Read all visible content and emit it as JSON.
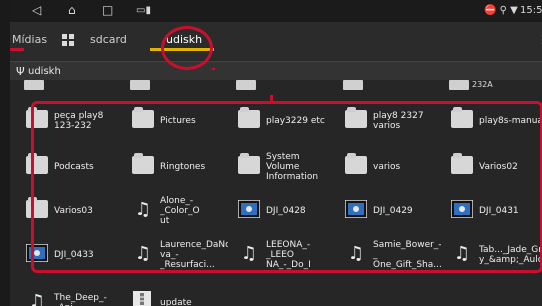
{
  "status": {
    "nav_back": "◁",
    "nav_home": "⌂",
    "nav_recent": "□",
    "status_icons": "⛔ ⚲ ▼",
    "time": "15:5"
  },
  "tabs": [
    {
      "label": "Mídias",
      "active": false
    },
    {
      "label": "",
      "active": false,
      "icon": "grid-icon"
    },
    {
      "label": "sdcard",
      "active": false
    },
    {
      "label": "udiskh",
      "active": true
    }
  ],
  "path": {
    "icon": "usb-icon",
    "label": "udiskh"
  },
  "top_partial": {
    "last_label": "232A"
  },
  "items": [
    {
      "name": "peça play8\n123-232",
      "type": "folder"
    },
    {
      "name": "Pictures",
      "type": "folder"
    },
    {
      "name": "play3229 etc",
      "type": "folder"
    },
    {
      "name": "play8 2327\nvarios",
      "type": "folder"
    },
    {
      "name": "play8s-manual",
      "type": "folder"
    },
    {
      "name": "Podcasts",
      "type": "folder"
    },
    {
      "name": "Ringtones",
      "type": "folder"
    },
    {
      "name": "System Volume\nInformation",
      "type": "folder"
    },
    {
      "name": "varios",
      "type": "folder"
    },
    {
      "name": "Varios02",
      "type": "folder"
    },
    {
      "name": "Varios03",
      "type": "folder"
    },
    {
      "name": "Alone_-_Color_O\nut",
      "type": "music"
    },
    {
      "name": "DJI_0428",
      "type": "video"
    },
    {
      "name": "DJI_0429",
      "type": "video"
    },
    {
      "name": "DJI_0431",
      "type": "video"
    },
    {
      "name": "DJI_0433",
      "type": "video"
    },
    {
      "name": "Laurence_DaNo\nva_-_Resurfaci...",
      "type": "music"
    },
    {
      "name": "LEEONA_-_LEEO\nNA_-_Do_I",
      "type": "music"
    },
    {
      "name": "Samie_Bower_-_\nOne_Gift_Sha...",
      "type": "music"
    },
    {
      "name": "Tab..._Jade_Grit\ny_&amp;_Aulc)",
      "type": "music"
    },
    {
      "name": "The_Deep_-_Ani",
      "type": "music"
    },
    {
      "name": "update",
      "type": "archive"
    }
  ],
  "colors": {
    "highlight": "#c8102e",
    "tab_accent": "#e2b300"
  }
}
